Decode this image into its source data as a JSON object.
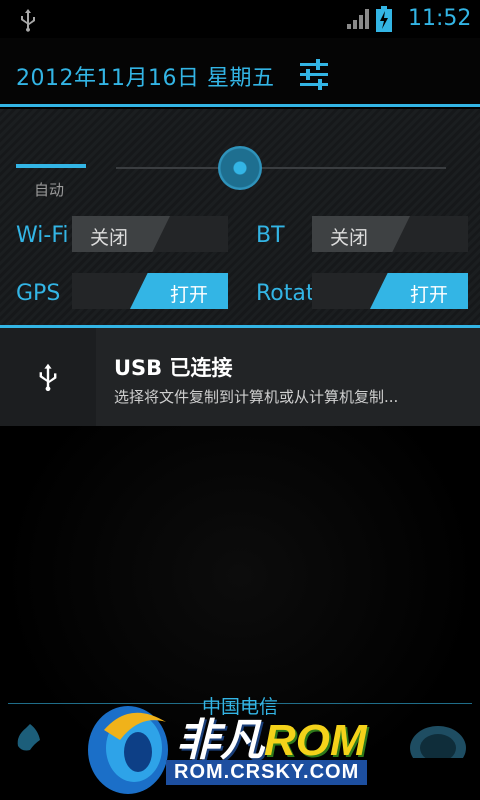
{
  "status_bar": {
    "time": "11:52",
    "icons": [
      "usb-icon",
      "signal-icon",
      "battery-charging-icon"
    ],
    "accent": "#33b5e5"
  },
  "header": {
    "date": "2012年11月16日 星期五",
    "settings_icon": "settings-sliders-icon"
  },
  "brightness": {
    "auto_label": "自动"
  },
  "toggles": [
    {
      "label": "Wi-Fi",
      "state": "关闭",
      "on": false
    },
    {
      "label": "BT",
      "state": "关闭",
      "on": false
    },
    {
      "label": "GPS",
      "state": "打开",
      "on": true
    },
    {
      "label": "Rotate",
      "state": "打开",
      "on": true
    }
  ],
  "notification": {
    "icon": "usb-icon",
    "title": "USB 已连接",
    "text": "选择将文件复制到计算机或从计算机复制..."
  },
  "lockscreen": {
    "carrier": "中国电信"
  },
  "watermark": {
    "brand_a": "非凡",
    "brand_b": "ROM",
    "url": "ROM.CRSKY.COM"
  }
}
